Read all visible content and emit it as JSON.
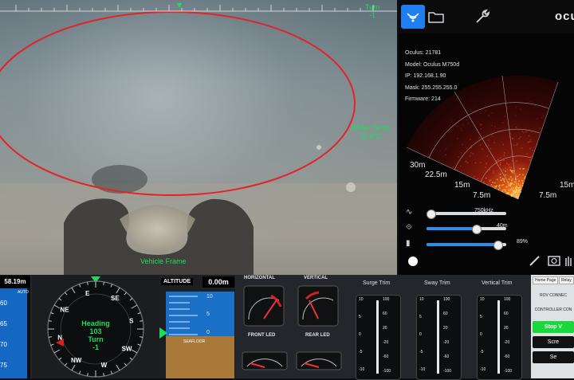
{
  "camera": {
    "heading_scale_label": "Turn",
    "turn_value": "-1",
    "water_temp_label": "Water Temp",
    "water_temp_value": "15.8°C",
    "overlay_label": "Vehicle Frame"
  },
  "sonar": {
    "brand": "ocu",
    "info": {
      "oculus": "Oculus: 21781",
      "model": "Model: Oculus M750d",
      "ip": "IP: 192.168.1.90",
      "mask": "Mask: 255.255.255.0",
      "firmware": "Firmware: 214"
    },
    "ranges": [
      "30m",
      "22.5m",
      "15m",
      "7.5m",
      "15m",
      "7.5m"
    ],
    "sliders": [
      {
        "icon": "frequency-icon",
        "value_label": "750kHz",
        "level": 0.05
      },
      {
        "icon": "range-icon",
        "value_label": "40m",
        "level": 0.62
      },
      {
        "icon": "gain-icon",
        "value_label": "89%",
        "level": 0.89
      }
    ],
    "icons": [
      "sonar-icon",
      "folder-icon",
      "wrench-icon",
      "record-icon",
      "pen-icon",
      "camera-icon",
      "hand-icon"
    ]
  },
  "depth": {
    "value": "58.19m",
    "mode": "AUTO",
    "ticks": [
      "60",
      "65",
      "70",
      "75"
    ]
  },
  "compass": {
    "heading_label": "Heading",
    "heading_value": "103",
    "turn_label": "Turn",
    "turn_value": "-1",
    "cardinals": [
      "N",
      "NE",
      "E",
      "SE",
      "S",
      "SW",
      "W",
      "NW"
    ]
  },
  "altitude": {
    "title": "ALTITUDE",
    "value": "0.00m",
    "ticks": [
      "10",
      "5",
      "0"
    ],
    "seafloor_label": "SEAFLOOR"
  },
  "gauges": {
    "horizontal_title": "HORIZONTAL",
    "vertical_title": "VERTICAL",
    "front_led_title": "FRONT LED",
    "rear_led_title": "REAR LED"
  },
  "trims": [
    {
      "title": "Surge Trim",
      "left": [
        "10",
        "5",
        "0",
        "-5",
        "-10"
      ],
      "right": [
        "100",
        "60",
        "20",
        "-20",
        "-60",
        "-100"
      ]
    },
    {
      "title": "Sway Trim",
      "left": [
        "10",
        "5",
        "0",
        "-5",
        "-10"
      ],
      "right": [
        "100",
        "60",
        "20",
        "-20",
        "-60",
        "-100"
      ]
    },
    {
      "title": "Vertical Trim",
      "left": [
        "10",
        "5",
        "0",
        "-5",
        "-10"
      ],
      "right": [
        "100",
        "60",
        "20",
        "-20",
        "-60",
        "-100"
      ]
    }
  ],
  "controls": {
    "tab_home": "Home Page",
    "tab_other": "Relay",
    "rov_conn": "ROV CONNEC",
    "controller_conn": "CONTROLLER CON",
    "stop_btn": "Stop V",
    "btn2": "Scre",
    "btn3": "Se",
    "colors": {
      "green": "#19d83e",
      "dark": "#111111"
    }
  }
}
